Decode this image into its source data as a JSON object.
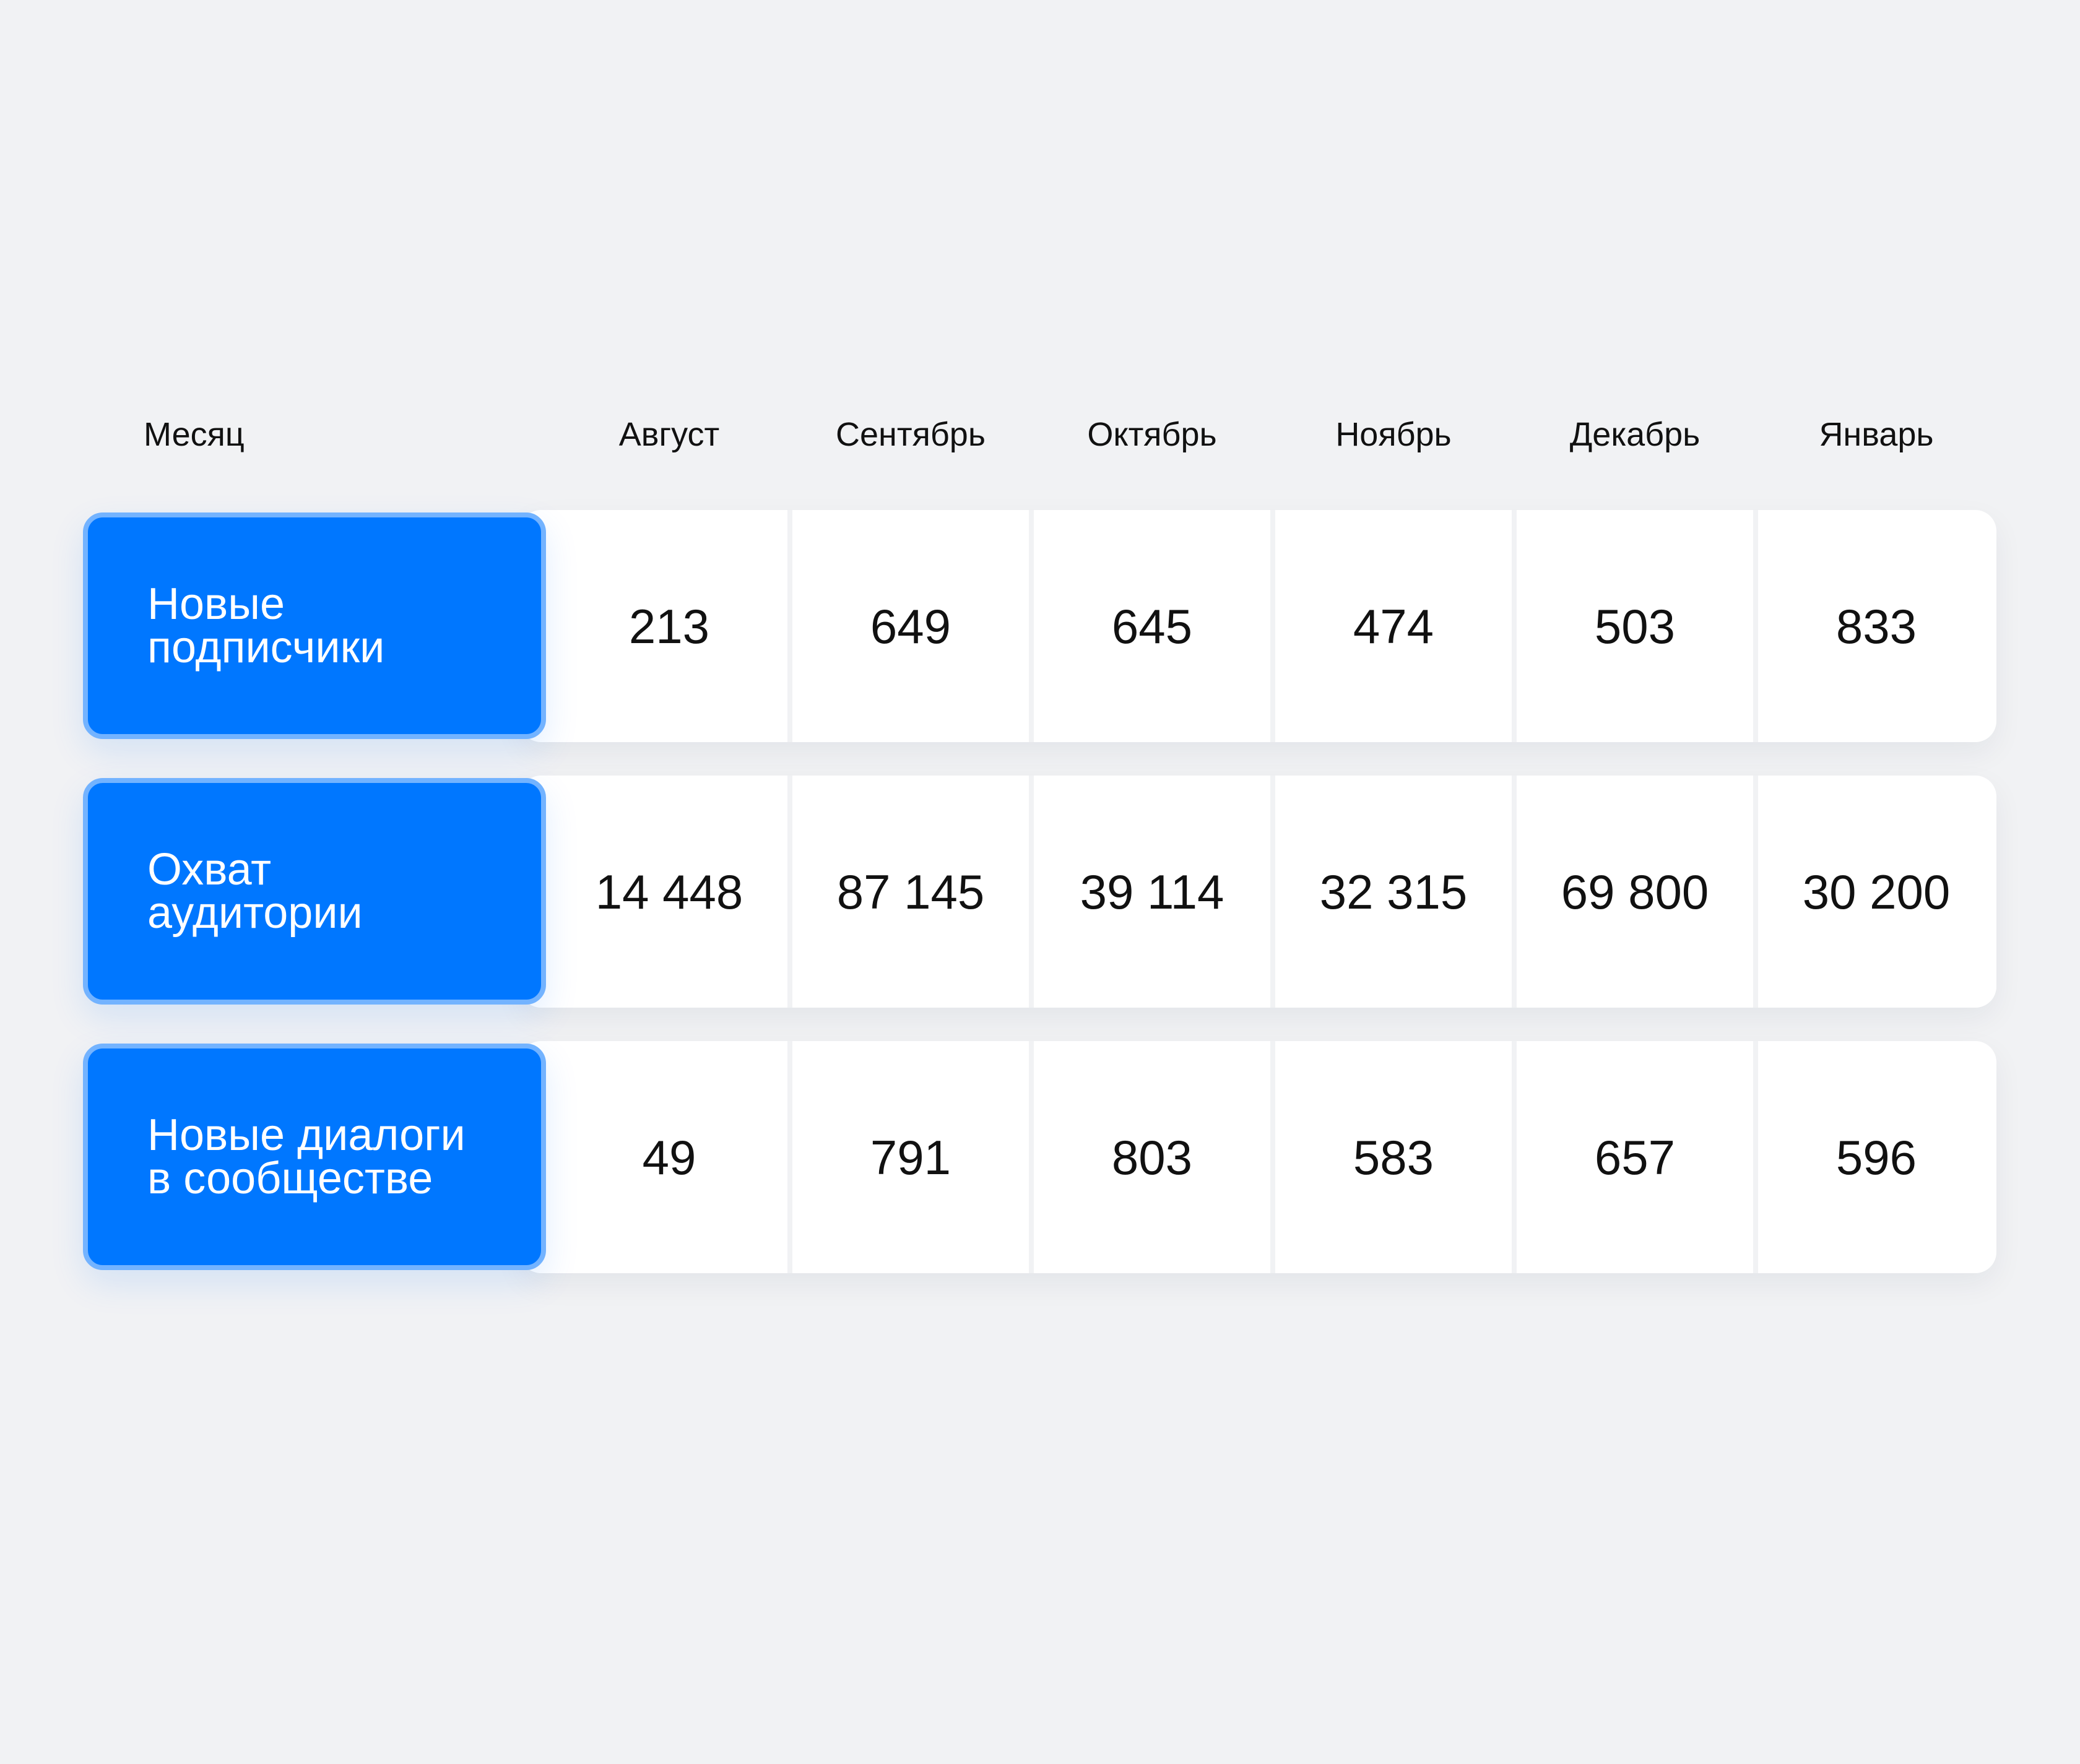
{
  "chart_data": {
    "type": "table",
    "header": {
      "row_label": "Месяц",
      "columns": [
        "Август",
        "Сентябрь",
        "Октябрь",
        "Ноябрь",
        "Декабрь",
        "Январь"
      ]
    },
    "rows": [
      {
        "label": "Новые\nподписчики",
        "values": [
          213,
          649,
          645,
          474,
          503,
          833
        ],
        "display": [
          "213",
          "649",
          "645",
          "474",
          "503",
          "833"
        ]
      },
      {
        "label": "Охват\nаудитории",
        "values": [
          14448,
          87145,
          39114,
          32315,
          69800,
          30200
        ],
        "display": [
          "14 448",
          "87 145",
          "39 114",
          "32 315",
          "69 800",
          "30 200"
        ]
      },
      {
        "label": "Новые диалоги\nв сообществе",
        "values": [
          49,
          791,
          803,
          583,
          657,
          596
        ],
        "display": [
          "49",
          "791",
          "803",
          "583",
          "657",
          "596"
        ]
      }
    ]
  },
  "colors": {
    "background": "#f1f2f4",
    "label_fill": "#0077ff",
    "label_border": "#73b3ff",
    "card_fill": "#ffffff",
    "text": "#111111",
    "label_text": "#ffffff"
  }
}
